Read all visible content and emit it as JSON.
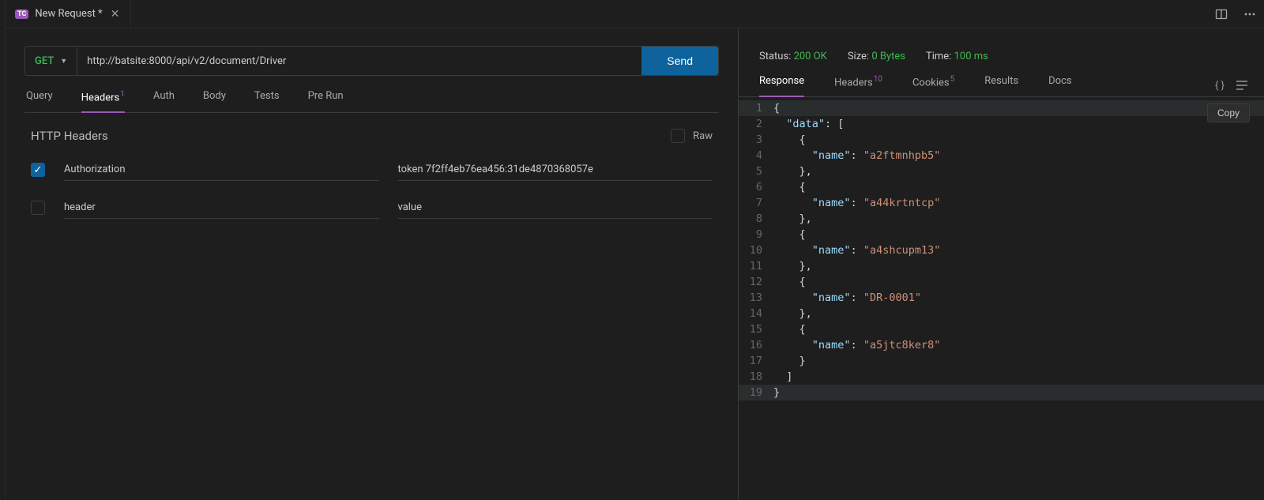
{
  "tab": {
    "icon_text": "TC",
    "title": "New Request *"
  },
  "toolbar_icons": {
    "split": "split-layout-icon",
    "more": "more-icon"
  },
  "request": {
    "method": "GET",
    "url": "http://batsite:8000/api/v2/document/Driver",
    "send_label": "Send",
    "tabs": [
      {
        "label": "Query",
        "active": false
      },
      {
        "label": "Headers",
        "active": true,
        "badge": "1"
      },
      {
        "label": "Auth",
        "active": false
      },
      {
        "label": "Body",
        "active": false
      },
      {
        "label": "Tests",
        "active": false
      },
      {
        "label": "Pre Run",
        "active": false
      }
    ],
    "headers_title": "HTTP Headers",
    "raw_label": "Raw",
    "header_rows": [
      {
        "enabled": true,
        "name": "Authorization",
        "value": "token 7f2ff4eb76ea456:31de4870368057e"
      },
      {
        "enabled": false,
        "name_placeholder": "header",
        "value_placeholder": "value"
      }
    ]
  },
  "response": {
    "status_label": "Status:",
    "status_value": "200 OK",
    "size_label": "Size:",
    "size_value": "0 Bytes",
    "time_label": "Time:",
    "time_value": "100 ms",
    "tabs": [
      {
        "label": "Response",
        "active": true
      },
      {
        "label": "Headers",
        "badge": "10"
      },
      {
        "label": "Cookies",
        "badge": "5"
      },
      {
        "label": "Results"
      },
      {
        "label": "Docs"
      }
    ],
    "copy_label": "Copy",
    "body_lines": [
      {
        "n": 1,
        "indent": 0,
        "tokens": [
          [
            "punc",
            "{"
          ]
        ],
        "hl": true
      },
      {
        "n": 2,
        "indent": 1,
        "tokens": [
          [
            "key",
            "\"data\""
          ],
          [
            "punc",
            ": ["
          ]
        ]
      },
      {
        "n": 3,
        "indent": 2,
        "tokens": [
          [
            "punc",
            "{"
          ]
        ]
      },
      {
        "n": 4,
        "indent": 3,
        "tokens": [
          [
            "key",
            "\"name\""
          ],
          [
            "punc",
            ": "
          ],
          [
            "str",
            "\"a2ftmnhpb5\""
          ]
        ]
      },
      {
        "n": 5,
        "indent": 2,
        "tokens": [
          [
            "punc",
            "},"
          ]
        ]
      },
      {
        "n": 6,
        "indent": 2,
        "tokens": [
          [
            "punc",
            "{"
          ]
        ]
      },
      {
        "n": 7,
        "indent": 3,
        "tokens": [
          [
            "key",
            "\"name\""
          ],
          [
            "punc",
            ": "
          ],
          [
            "str",
            "\"a44krtntcp\""
          ]
        ]
      },
      {
        "n": 8,
        "indent": 2,
        "tokens": [
          [
            "punc",
            "},"
          ]
        ]
      },
      {
        "n": 9,
        "indent": 2,
        "tokens": [
          [
            "punc",
            "{"
          ]
        ]
      },
      {
        "n": 10,
        "indent": 3,
        "tokens": [
          [
            "key",
            "\"name\""
          ],
          [
            "punc",
            ": "
          ],
          [
            "str",
            "\"a4shcupm13\""
          ]
        ]
      },
      {
        "n": 11,
        "indent": 2,
        "tokens": [
          [
            "punc",
            "},"
          ]
        ]
      },
      {
        "n": 12,
        "indent": 2,
        "tokens": [
          [
            "punc",
            "{"
          ]
        ]
      },
      {
        "n": 13,
        "indent": 3,
        "tokens": [
          [
            "key",
            "\"name\""
          ],
          [
            "punc",
            ": "
          ],
          [
            "str",
            "\"DR-0001\""
          ]
        ]
      },
      {
        "n": 14,
        "indent": 2,
        "tokens": [
          [
            "punc",
            "},"
          ]
        ]
      },
      {
        "n": 15,
        "indent": 2,
        "tokens": [
          [
            "punc",
            "{"
          ]
        ]
      },
      {
        "n": 16,
        "indent": 3,
        "tokens": [
          [
            "key",
            "\"name\""
          ],
          [
            "punc",
            ": "
          ],
          [
            "str",
            "\"a5jtc8ker8\""
          ]
        ]
      },
      {
        "n": 17,
        "indent": 2,
        "tokens": [
          [
            "punc",
            "}"
          ]
        ]
      },
      {
        "n": 18,
        "indent": 1,
        "tokens": [
          [
            "punc",
            "]"
          ]
        ]
      },
      {
        "n": 19,
        "indent": 0,
        "tokens": [
          [
            "punc",
            "}"
          ]
        ],
        "hl": true
      }
    ]
  }
}
